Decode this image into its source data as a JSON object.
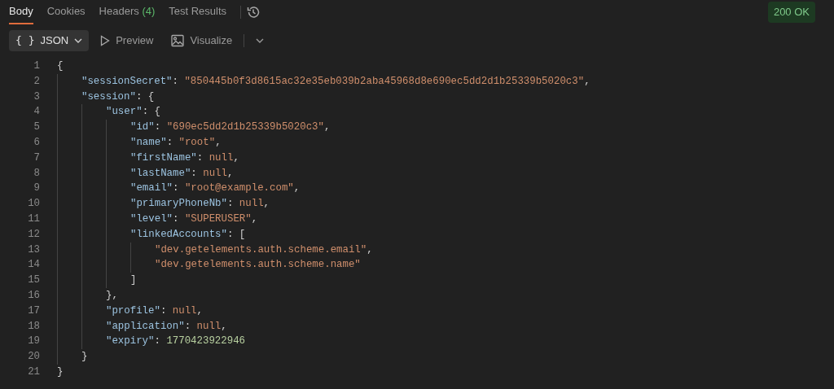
{
  "tabs": [
    {
      "label": "Body",
      "selected": true
    },
    {
      "label": "Cookies",
      "selected": false
    },
    {
      "label": "Headers",
      "count": "(4)",
      "selected": false
    },
    {
      "label": "Test Results",
      "selected": false
    }
  ],
  "status": "200 OK",
  "view_options": [
    {
      "kind": "format",
      "icon": "{ }",
      "label": "JSON",
      "selected": true
    },
    {
      "kind": "preview",
      "label": "Preview",
      "selected": false
    },
    {
      "kind": "visualize",
      "label": "Visualize",
      "selected": false
    }
  ],
  "lines": [
    {
      "number": "1",
      "tokens": [
        {
          "kind": "punct",
          "text": "{"
        }
      ],
      "children": [
        {
          "number": "2",
          "tokens": [
            {
              "kind": "key",
              "text": "\"sessionSecret\""
            },
            {
              "kind": "punct",
              "text": ": "
            },
            {
              "kind": "string",
              "text": "\"850445b0f3d8615ac32e35eb039b2aba45968d8e690ec5dd2d1b25339b5020c3\""
            },
            {
              "kind": "punct",
              "text": ","
            }
          ]
        },
        {
          "number": "3",
          "tokens": [
            {
              "kind": "key",
              "text": "\"session\""
            },
            {
              "kind": "punct",
              "text": ": {"
            }
          ],
          "children": [
            {
              "number": "4",
              "tokens": [
                {
                  "kind": "key",
                  "text": "\"user\""
                },
                {
                  "kind": "punct",
                  "text": ": {"
                }
              ],
              "children": [
                {
                  "number": "5",
                  "tokens": [
                    {
                      "kind": "key",
                      "text": "\"id\""
                    },
                    {
                      "kind": "punct",
                      "text": ": "
                    },
                    {
                      "kind": "string",
                      "text": "\"690ec5dd2d1b25339b5020c3\""
                    },
                    {
                      "kind": "punct",
                      "text": ","
                    }
                  ]
                },
                {
                  "number": "6",
                  "tokens": [
                    {
                      "kind": "key",
                      "text": "\"name\""
                    },
                    {
                      "kind": "punct",
                      "text": ": "
                    },
                    {
                      "kind": "string",
                      "text": "\"root\""
                    },
                    {
                      "kind": "punct",
                      "text": ","
                    }
                  ]
                },
                {
                  "number": "7",
                  "tokens": [
                    {
                      "kind": "key",
                      "text": "\"firstName\""
                    },
                    {
                      "kind": "punct",
                      "text": ": "
                    },
                    {
                      "kind": "null",
                      "text": "null"
                    },
                    {
                      "kind": "punct",
                      "text": ","
                    }
                  ]
                },
                {
                  "number": "8",
                  "tokens": [
                    {
                      "kind": "key",
                      "text": "\"lastName\""
                    },
                    {
                      "kind": "punct",
                      "text": ": "
                    },
                    {
                      "kind": "null",
                      "text": "null"
                    },
                    {
                      "kind": "punct",
                      "text": ","
                    }
                  ]
                },
                {
                  "number": "9",
                  "tokens": [
                    {
                      "kind": "key",
                      "text": "\"email\""
                    },
                    {
                      "kind": "punct",
                      "text": ": "
                    },
                    {
                      "kind": "string",
                      "text": "\"root@example.com\""
                    },
                    {
                      "kind": "punct",
                      "text": ","
                    }
                  ]
                },
                {
                  "number": "10",
                  "tokens": [
                    {
                      "kind": "key",
                      "text": "\"primaryPhoneNb\""
                    },
                    {
                      "kind": "punct",
                      "text": ": "
                    },
                    {
                      "kind": "null",
                      "text": "null"
                    },
                    {
                      "kind": "punct",
                      "text": ","
                    }
                  ]
                },
                {
                  "number": "11",
                  "tokens": [
                    {
                      "kind": "key",
                      "text": "\"level\""
                    },
                    {
                      "kind": "punct",
                      "text": ": "
                    },
                    {
                      "kind": "string",
                      "text": "\"SUPERUSER\""
                    },
                    {
                      "kind": "punct",
                      "text": ","
                    }
                  ]
                },
                {
                  "number": "12",
                  "tokens": [
                    {
                      "kind": "key",
                      "text": "\"linkedAccounts\""
                    },
                    {
                      "kind": "punct",
                      "text": ": ["
                    }
                  ],
                  "children": [
                    {
                      "number": "13",
                      "tokens": [
                        {
                          "kind": "string",
                          "text": "\"dev.getelements.auth.scheme.email\""
                        },
                        {
                          "kind": "punct",
                          "text": ","
                        }
                      ]
                    },
                    {
                      "number": "14",
                      "tokens": [
                        {
                          "kind": "string",
                          "text": "\"dev.getelements.auth.scheme.name\""
                        }
                      ]
                    }
                  ]
                },
                {
                  "number": "15",
                  "tokens": [
                    {
                      "kind": "punct",
                      "text": "]"
                    }
                  ]
                }
              ]
            },
            {
              "number": "16",
              "tokens": [
                {
                  "kind": "punct",
                  "text": "},"
                }
              ]
            },
            {
              "number": "17",
              "tokens": [
                {
                  "kind": "key",
                  "text": "\"profile\""
                },
                {
                  "kind": "punct",
                  "text": ": "
                },
                {
                  "kind": "null",
                  "text": "null"
                },
                {
                  "kind": "punct",
                  "text": ","
                }
              ]
            },
            {
              "number": "18",
              "tokens": [
                {
                  "kind": "key",
                  "text": "\"application\""
                },
                {
                  "kind": "punct",
                  "text": ": "
                },
                {
                  "kind": "null",
                  "text": "null"
                },
                {
                  "kind": "punct",
                  "text": ","
                }
              ]
            },
            {
              "number": "19",
              "tokens": [
                {
                  "kind": "key",
                  "text": "\"expiry\""
                },
                {
                  "kind": "punct",
                  "text": ": "
                },
                {
                  "kind": "number",
                  "text": "1770423922946"
                }
              ]
            }
          ]
        },
        {
          "number": "20",
          "tokens": [
            {
              "kind": "punct",
              "text": "}"
            }
          ]
        }
      ]
    },
    {
      "number": "21",
      "tokens": [
        {
          "kind": "punct",
          "text": "}"
        }
      ]
    }
  ]
}
